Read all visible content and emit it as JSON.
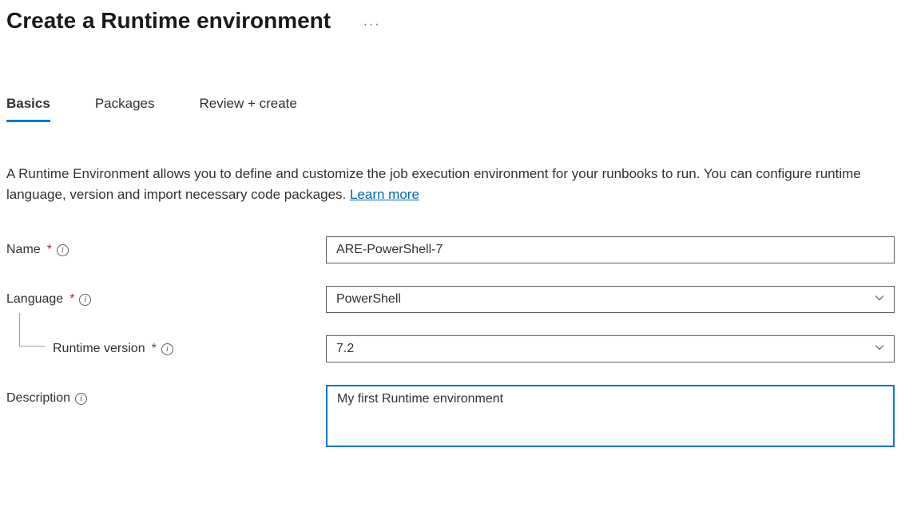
{
  "header": {
    "title": "Create a Runtime environment"
  },
  "tabs": [
    {
      "label": "Basics",
      "active": true
    },
    {
      "label": "Packages",
      "active": false
    },
    {
      "label": "Review + create",
      "active": false
    }
  ],
  "intro": {
    "text": "A Runtime Environment allows you to define and customize the job execution environment for your runbooks to run. You can configure runtime language, version and import necessary code packages. ",
    "learn_more": "Learn more"
  },
  "fields": {
    "name": {
      "label": "Name",
      "value": "ARE-PowerShell-7",
      "required": true
    },
    "language": {
      "label": "Language",
      "value": "PowerShell",
      "required": true
    },
    "runtime_version": {
      "label": "Runtime version",
      "value": "7.2",
      "required": true
    },
    "description": {
      "label": "Description",
      "value": "My first Runtime environment",
      "required": false
    }
  }
}
